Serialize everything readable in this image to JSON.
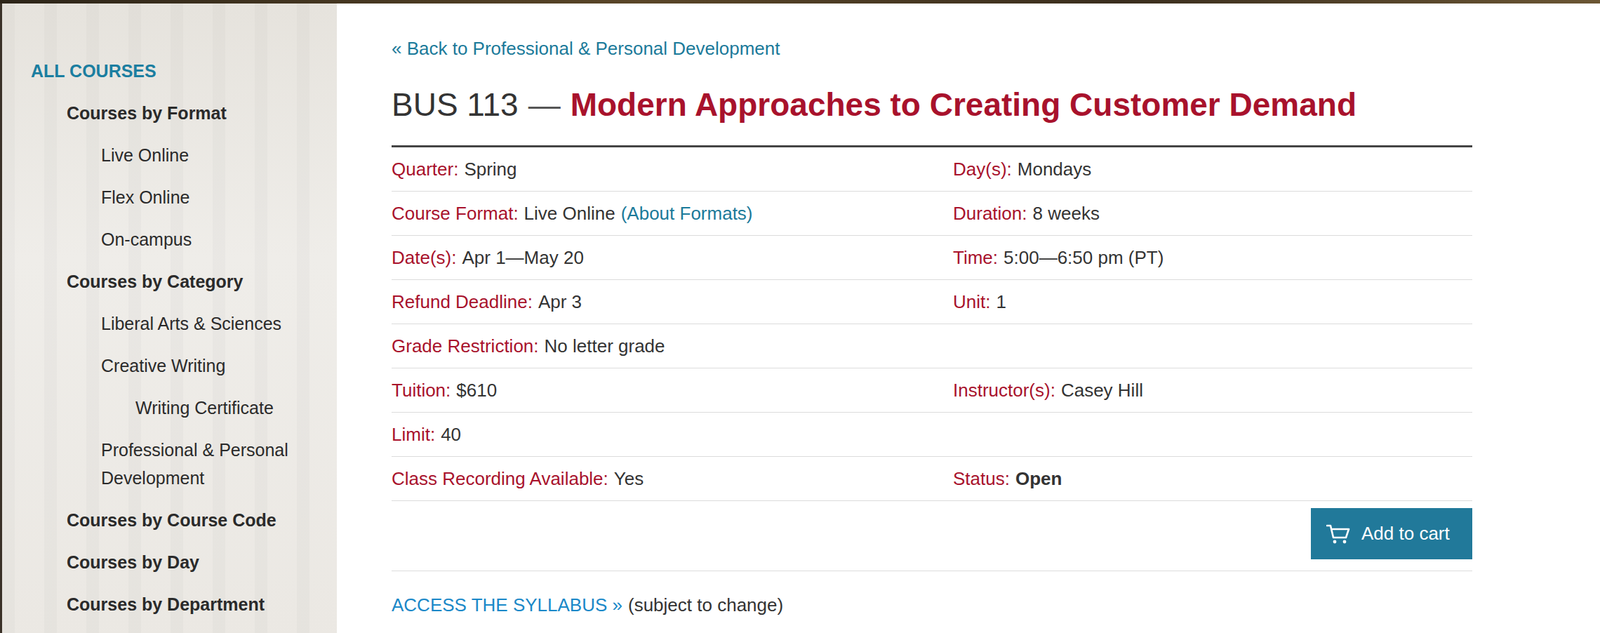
{
  "sidebar": {
    "heading": "ALL COURSES",
    "items": [
      {
        "label": "Courses by Format",
        "children": [
          {
            "label": "Live Online"
          },
          {
            "label": "Flex Online"
          },
          {
            "label": "On-campus"
          }
        ]
      },
      {
        "label": "Courses by Category",
        "children": [
          {
            "label": "Liberal Arts & Sciences"
          },
          {
            "label": "Creative Writing",
            "children": [
              {
                "label": "Writing Certificate"
              }
            ]
          },
          {
            "label": "Professional & Personal Development"
          }
        ]
      },
      {
        "label": "Courses by Course Code"
      },
      {
        "label": "Courses by Day"
      },
      {
        "label": "Courses by Department"
      }
    ]
  },
  "back_link": "« Back to Professional & Personal Development",
  "course": {
    "code": "BUS 113",
    "separator": "—",
    "title": "Modern Approaches to Creating Customer Demand"
  },
  "details": [
    {
      "left": {
        "label": "Quarter:",
        "value": "Spring",
        "kind": "plain"
      },
      "right": {
        "label": "Day(s):",
        "value": "Mondays",
        "kind": "plain"
      }
    },
    {
      "left": {
        "label": "Course Format:",
        "value": "Live Online",
        "link": "(About Formats)",
        "kind": "plain"
      },
      "right": {
        "label": "Duration:",
        "value": "8 weeks",
        "kind": "plain"
      }
    },
    {
      "left": {
        "label": "Date(s):",
        "value": "Apr 1—May 20",
        "kind": "plain"
      },
      "right": {
        "label": "Time:",
        "value": "5:00—6:50 pm (PT)",
        "kind": "plain"
      }
    },
    {
      "left": {
        "label": "Refund Deadline:",
        "value": "Apr 3",
        "kind": "plain"
      },
      "right": {
        "label": "Unit:",
        "value": "1",
        "kind": "plain"
      }
    },
    {
      "left": {
        "label": "Grade Restriction:",
        "value": "No letter grade",
        "kind": "plain"
      },
      "right": null
    },
    {
      "left": {
        "label": "Tuition:",
        "value": "$610",
        "kind": "plain"
      },
      "right": {
        "label": "Instructor(s):",
        "value": "Casey Hill",
        "kind": "plain"
      }
    },
    {
      "left": {
        "label": "Limit:",
        "value": "40",
        "kind": "plain"
      },
      "right": null
    },
    {
      "left": {
        "label": "Class Recording Available:",
        "value": "Yes",
        "kind": "plain"
      },
      "right": {
        "label": "Status:",
        "value": "Open",
        "kind": "status"
      }
    }
  ],
  "cart_button": "Add to cart",
  "syllabus": {
    "link": "ACCESS THE SYLLABUS »",
    "note": "(subject to change)"
  }
}
